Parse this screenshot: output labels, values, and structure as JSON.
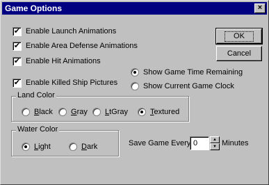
{
  "window": {
    "title": "Game Options",
    "close_glyph": "×"
  },
  "checkboxes": {
    "launch": {
      "label": "Enable Launch Animations",
      "checked": true
    },
    "area_defense": {
      "label": "Enable Area Defense Animations",
      "checked": true
    },
    "hit": {
      "label": "Enable Hit Animations",
      "checked": true
    },
    "killed_ship": {
      "label": "Enable Killed Ship Pictures",
      "checked": true
    }
  },
  "check_glyph": "✔",
  "time_display": {
    "remaining_label": "Show Game Time Remaining",
    "clock_label": "Show Current Game Clock",
    "selected": "remaining"
  },
  "land_color": {
    "title": "Land Color",
    "options": [
      {
        "key": "B",
        "rest": "lack"
      },
      {
        "key": "G",
        "rest": "ray"
      },
      {
        "key": "L",
        "pre": "",
        "rest": "tGray"
      },
      {
        "key": "T",
        "rest": "extured"
      }
    ],
    "selected": "Textured"
  },
  "water_color": {
    "title": "Water Color",
    "options": [
      {
        "key": "L",
        "rest": "ight"
      },
      {
        "key": "D",
        "rest": "ark"
      }
    ],
    "selected": "Light"
  },
  "save": {
    "label": "Save Game Every",
    "value": "0",
    "units": "Minutes"
  },
  "buttons": {
    "ok": "OK",
    "cancel": "Cancel"
  }
}
